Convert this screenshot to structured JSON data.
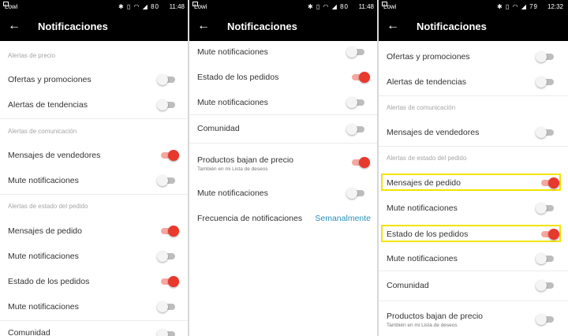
{
  "panel1": {
    "status": {
      "carrier": "Lowi",
      "time": "11:48",
      "battery": "80"
    },
    "appbar": {
      "title": "Notificaciones"
    },
    "sections": [
      "Alertas de precio",
      "Alertas de comunicación",
      "Alertas de estado del pedido"
    ],
    "rows": [
      {
        "label": "Ofertas y promociones",
        "on": false
      },
      {
        "label": "Alertas de tendencias",
        "on": false
      },
      {
        "label": "Mensajes de vendedores",
        "on": true
      },
      {
        "label": "Mute notificaciones",
        "on": false
      },
      {
        "label": "Mensajes de pedido",
        "on": true
      },
      {
        "label": "Mute notificaciones",
        "on": false
      },
      {
        "label": "Estado de los pedidos",
        "on": true
      },
      {
        "label": "Mute notificaciones",
        "on": false
      },
      {
        "label": "Comunidad",
        "on": false
      }
    ]
  },
  "panel2": {
    "status": {
      "carrier": "Lowi",
      "time": "11:48",
      "battery": "80"
    },
    "appbar": {
      "title": "Notificaciones"
    },
    "rows": [
      {
        "label": "Mute notificaciones",
        "on": false
      },
      {
        "label": "Estado de los pedidos",
        "on": true
      },
      {
        "label": "Mute notificaciones",
        "on": false
      },
      {
        "label": "Comunidad",
        "on": false
      },
      {
        "label": "Productos bajan de precio",
        "sub": "También en mi Lista de deseos",
        "on": true
      },
      {
        "label": "Mute notificaciones",
        "on": false
      }
    ],
    "frequency": {
      "label": "Frecuencia de notificaciones",
      "value": "Semanalmente"
    }
  },
  "panel3": {
    "status": {
      "carrier": "Lowi",
      "time": "12:32",
      "battery": "79"
    },
    "appbar": {
      "title": "Notificaciones"
    },
    "sections": [
      "Alertas de comunicación",
      "Alertas de estado del pedido"
    ],
    "rows": [
      {
        "label": "Ofertas y promociones",
        "on": false
      },
      {
        "label": "Alertas de tendencias",
        "on": false
      },
      {
        "label": "Mensajes de vendedores",
        "on": false
      },
      {
        "label": "Mensajes de pedido",
        "on": true
      },
      {
        "label": "Mute notificaciones",
        "on": false
      },
      {
        "label": "Estado de los pedidos",
        "on": true
      },
      {
        "label": "Mute notificaciones",
        "on": false
      },
      {
        "label": "Comunidad",
        "on": false
      },
      {
        "label": "Productos bajan de precio",
        "sub": "También en mi Lista de deseos",
        "on": false
      }
    ]
  },
  "icons": {
    "back": "arrow-left-icon",
    "toggle": "switch-toggle"
  },
  "colors": {
    "toggle_on": "#e8392d",
    "toggle_on_track": "#f5a89f",
    "toggle_off_track": "#bdbdbd",
    "link": "#2a8fb8",
    "highlight": "#f2e400"
  }
}
